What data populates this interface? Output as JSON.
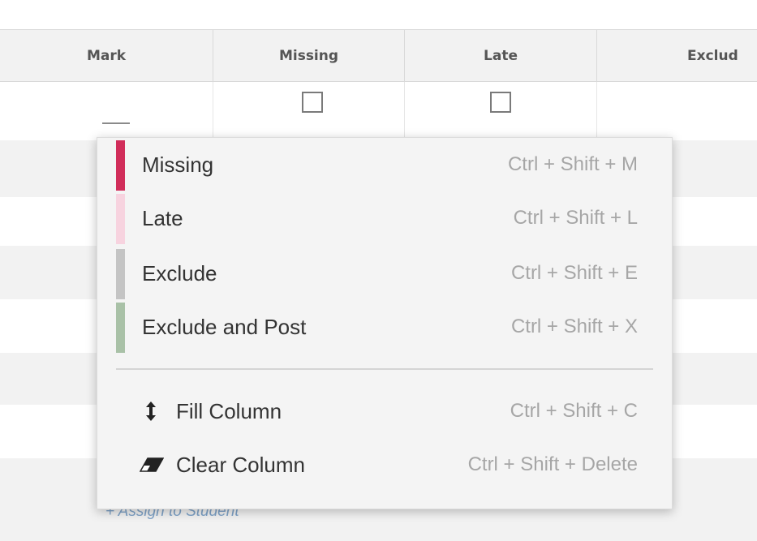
{
  "table": {
    "headers": {
      "mark": "Mark",
      "missing": "Missing",
      "late": "Late",
      "exclude": "Exclud"
    },
    "first_row": {
      "missing_checked": false,
      "late_checked": false
    },
    "assign_link": "+ Assign to Student"
  },
  "context_menu": {
    "status_items": [
      {
        "label": "Missing",
        "shortcut": "Ctrl + Shift + M",
        "color": "#d12d5a"
      },
      {
        "label": "Late",
        "shortcut": "Ctrl + Shift + L",
        "color": "#f7d3df"
      },
      {
        "label": "Exclude",
        "shortcut": "Ctrl + Shift + E",
        "color": "#c4c4c4"
      },
      {
        "label": "Exclude and Post",
        "shortcut": "Ctrl + Shift + X",
        "color": "#a9c1a7"
      }
    ],
    "actions": [
      {
        "label": "Fill Column",
        "shortcut": "Ctrl + Shift + C",
        "icon": "vertical-arrows-icon"
      },
      {
        "label": "Clear Column",
        "shortcut": "Ctrl + Shift + Delete",
        "icon": "eraser-icon"
      }
    ]
  }
}
